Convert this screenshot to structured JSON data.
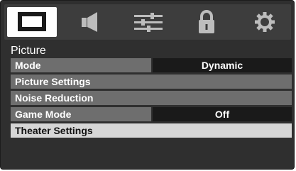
{
  "tabs": [
    {
      "icon": "picture-icon",
      "active": true
    },
    {
      "icon": "speaker-icon",
      "active": false
    },
    {
      "icon": "sliders-icon",
      "active": false
    },
    {
      "icon": "lock-icon",
      "active": false
    },
    {
      "icon": "gear-icon",
      "active": false
    }
  ],
  "section_title": "Picture",
  "menu": [
    {
      "label": "Mode",
      "value": "Dynamic"
    },
    {
      "label": "Picture Settings"
    },
    {
      "label": "Noise Reduction"
    },
    {
      "label": "Game Mode",
      "value": "Off"
    },
    {
      "label": "Theater Settings",
      "selected": true
    }
  ],
  "colors": {
    "panel": "#2f2f2f",
    "row": "#6e6e6e",
    "value_bg": "#1a1a1a",
    "selected": "#d6d6d6"
  }
}
